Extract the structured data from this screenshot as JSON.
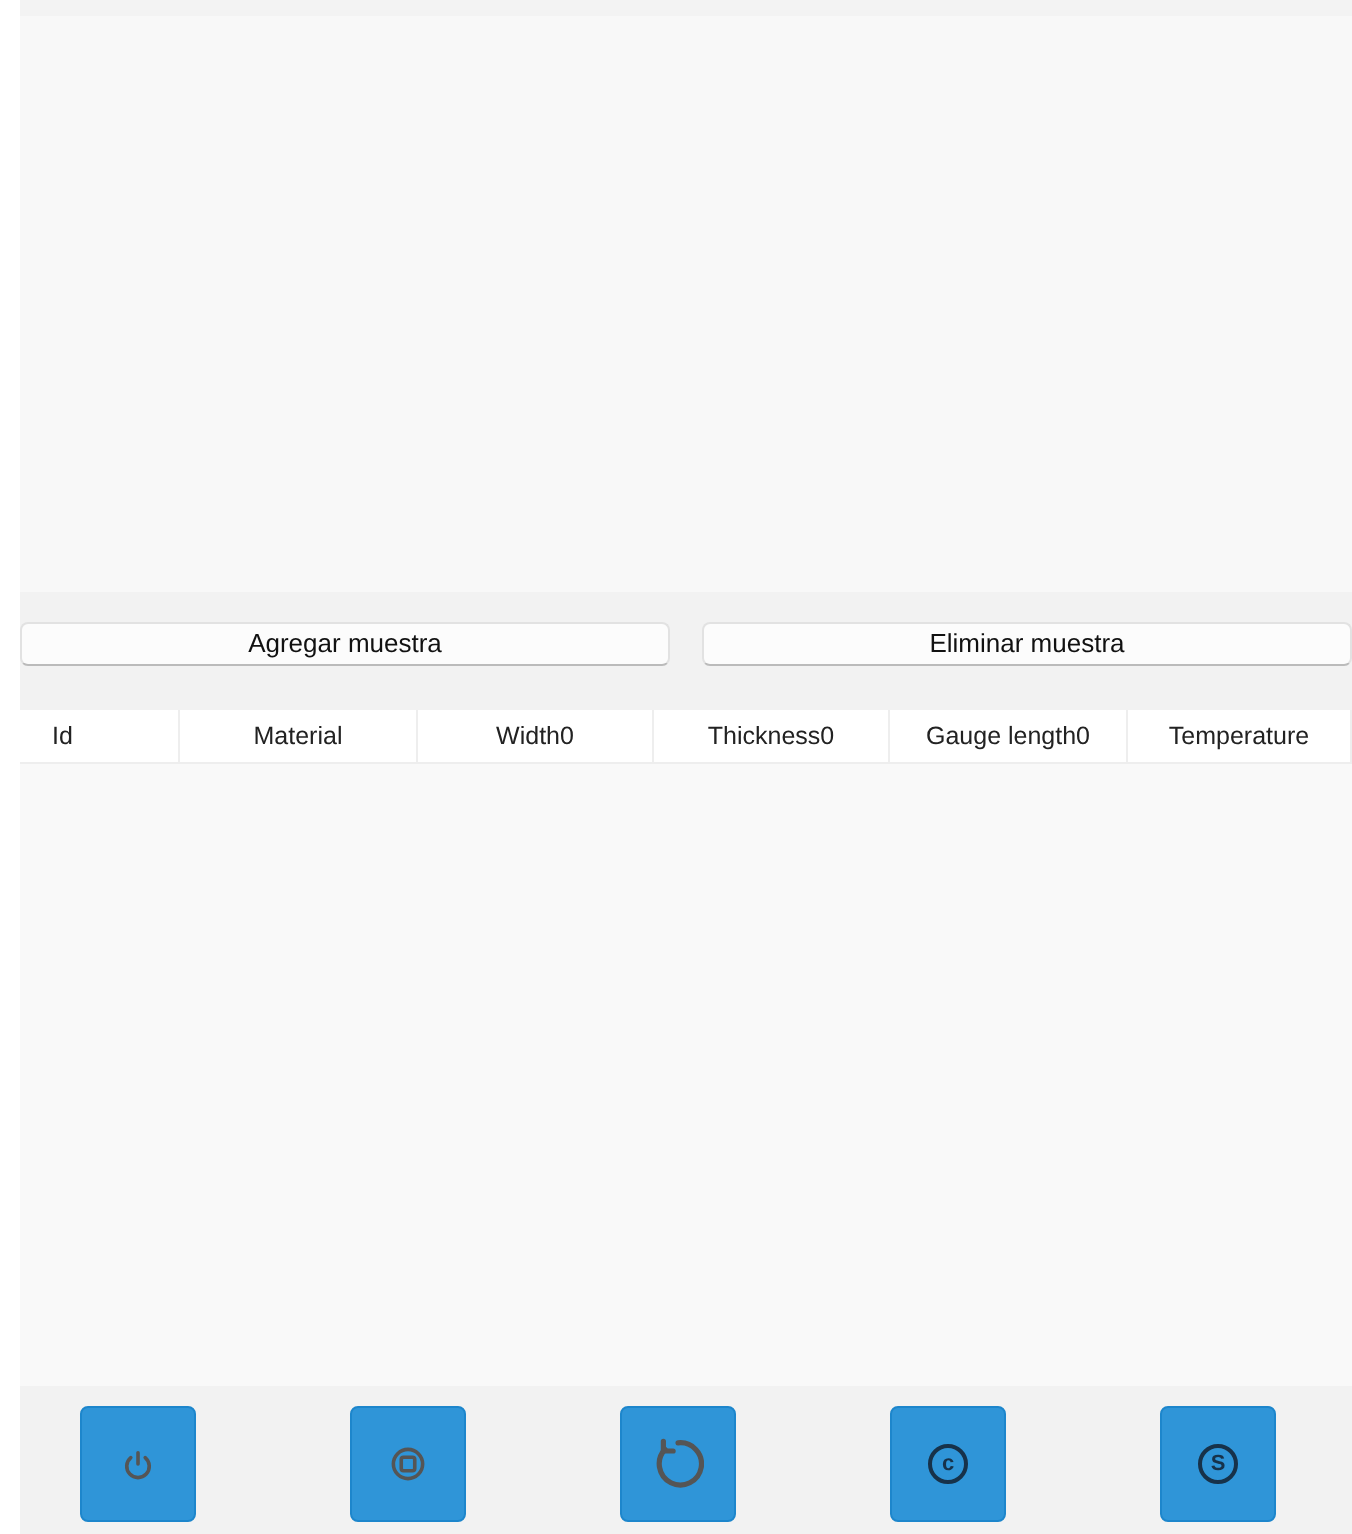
{
  "actions": [
    {
      "label": "Agregar muestra"
    },
    {
      "label": "Eliminar muestra"
    }
  ],
  "table": {
    "columns": [
      "Id",
      "Material",
      "Width0",
      "Thickness0",
      "Gauge length0",
      "Temperature"
    ]
  },
  "toolbar": [
    {
      "kind": "power"
    },
    {
      "kind": "stop"
    },
    {
      "kind": "refresh"
    },
    {
      "kind": "letter",
      "glyph": "c"
    },
    {
      "kind": "letter",
      "glyph": "S"
    }
  ]
}
